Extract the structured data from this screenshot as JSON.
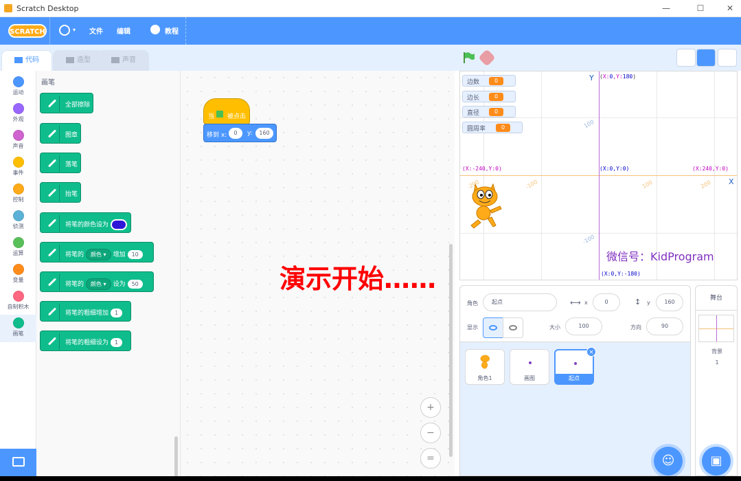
{
  "window": {
    "title": "Scratch Desktop",
    "minimize": "—",
    "maximize": "☐",
    "close": "✕"
  },
  "menubar": {
    "logo": "SCRATCH",
    "file": "文件",
    "edit": "编辑",
    "tutorials": "教程"
  },
  "tabs": {
    "code": "代码",
    "costumes": "造型",
    "sounds": "声音"
  },
  "categories": [
    {
      "label": "运动",
      "color": "#4c97ff"
    },
    {
      "label": "外观",
      "color": "#9966ff"
    },
    {
      "label": "声音",
      "color": "#cf63cf"
    },
    {
      "label": "事件",
      "color": "#ffbf00"
    },
    {
      "label": "控制",
      "color": "#ffab19"
    },
    {
      "label": "侦测",
      "color": "#5cb1d6"
    },
    {
      "label": "运算",
      "color": "#59c059"
    },
    {
      "label": "变量",
      "color": "#ff8c1a"
    },
    {
      "label": "自制积木",
      "color": "#ff6680"
    },
    {
      "label": "画笔",
      "color": "#0fbd8c"
    }
  ],
  "palette": {
    "heading": "画笔",
    "blocks": {
      "clear": "全部擦除",
      "stamp": "图章",
      "pen_down": "落笔",
      "pen_up": "抬笔",
      "set_color": "将笔的颜色设为",
      "change_param_a": "将笔的",
      "change_param_dd": "颜色 ▾",
      "change_param_b": "增加",
      "change_param_val": "10",
      "set_param_a": "将笔的",
      "set_param_dd": "颜色 ▾",
      "set_param_b": "设为",
      "set_param_val": "50",
      "change_size": "将笔的粗细增加",
      "change_size_val": "1",
      "set_size": "将笔的粗细设为",
      "set_size_val": "1"
    },
    "pen_color": "#2f17d8"
  },
  "script": {
    "hat_a": "当",
    "hat_b": "被点击",
    "goto_label": "移到 x:",
    "goto_x": "0",
    "goto_y_label": "y:",
    "goto_y": "160"
  },
  "overlay_text": "演示开始……",
  "zoom": {
    "in": "+",
    "out": "−",
    "reset": "="
  },
  "stage": {
    "monitors": [
      {
        "label": "边数",
        "value": "0"
      },
      {
        "label": "边长",
        "value": "0"
      },
      {
        "label": "直径",
        "value": "0"
      },
      {
        "label": "圆周率",
        "value": "0"
      }
    ],
    "top_label_p1": "(",
    "top_label_k1": "X:",
    "top_label_v1": "0",
    "top_label_k2": ",Y:",
    "top_label_v2": "180",
    "top_label_p2": ")",
    "center_label": "(X:0,Y:0)",
    "left_label": "(X:-240,Y:0)",
    "right_label": "(X:240,Y:0)",
    "bottom_label": "(X:0,Y:-180)",
    "axis_y": "Y",
    "axis_x": "X",
    "ticks_x": [
      "-200",
      "-100",
      "100",
      "200"
    ],
    "ticks_y": [
      "100",
      "-100"
    ],
    "watermark": "微信号：KidProgram"
  },
  "sprite_info": {
    "sprite_label": "角色",
    "sprite_name": "起点",
    "x_label": "x",
    "x_value": "0",
    "y_label": "y",
    "y_value": "160",
    "show_label": "显示",
    "size_label": "大小",
    "size_value": "100",
    "direction_label": "方向",
    "direction_value": "90"
  },
  "sprites": [
    {
      "name": "角色1"
    },
    {
      "name": "画图"
    },
    {
      "name": "起点"
    }
  ],
  "stage_panel": {
    "title": "舞台",
    "backdrops_label": "背景",
    "backdrops_count": "1"
  }
}
